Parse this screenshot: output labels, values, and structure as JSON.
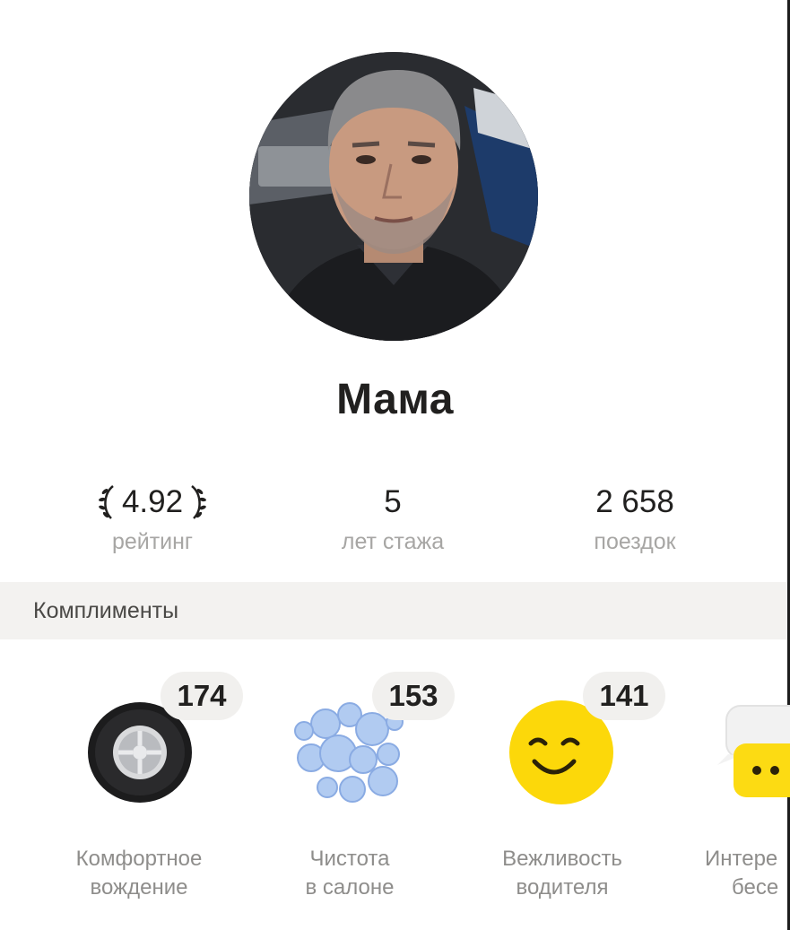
{
  "profile": {
    "name": "Мама",
    "photo": "driver-portrait-photo"
  },
  "stats": {
    "rating": {
      "value": "4.92",
      "label": "рейтинг"
    },
    "years": {
      "value": "5",
      "label": "лет стажа"
    },
    "trips": {
      "value": "2 658",
      "label": "поездок"
    }
  },
  "compliments": {
    "title": "Комплименты",
    "items": [
      {
        "count": "174",
        "label_line1": "Комфортное",
        "label_line2": "вождение",
        "icon": "tire-icon"
      },
      {
        "count": "153",
        "label_line1": "Чистота",
        "label_line2": "в салоне",
        "icon": "bubbles-icon"
      },
      {
        "count": "141",
        "label_line1": "Вежливость",
        "label_line2": "водителя",
        "icon": "smiley-icon"
      },
      {
        "count": "",
        "label_line1": "Интере",
        "label_line2": "бесе",
        "icon": "chat-bubble-icon"
      }
    ]
  },
  "colors": {
    "text": "#21201f",
    "muted": "#a7a6a4",
    "section_bg": "#f3f2f0",
    "smiley": "#fcd80a",
    "chat_bubble": "#fcdb13"
  }
}
